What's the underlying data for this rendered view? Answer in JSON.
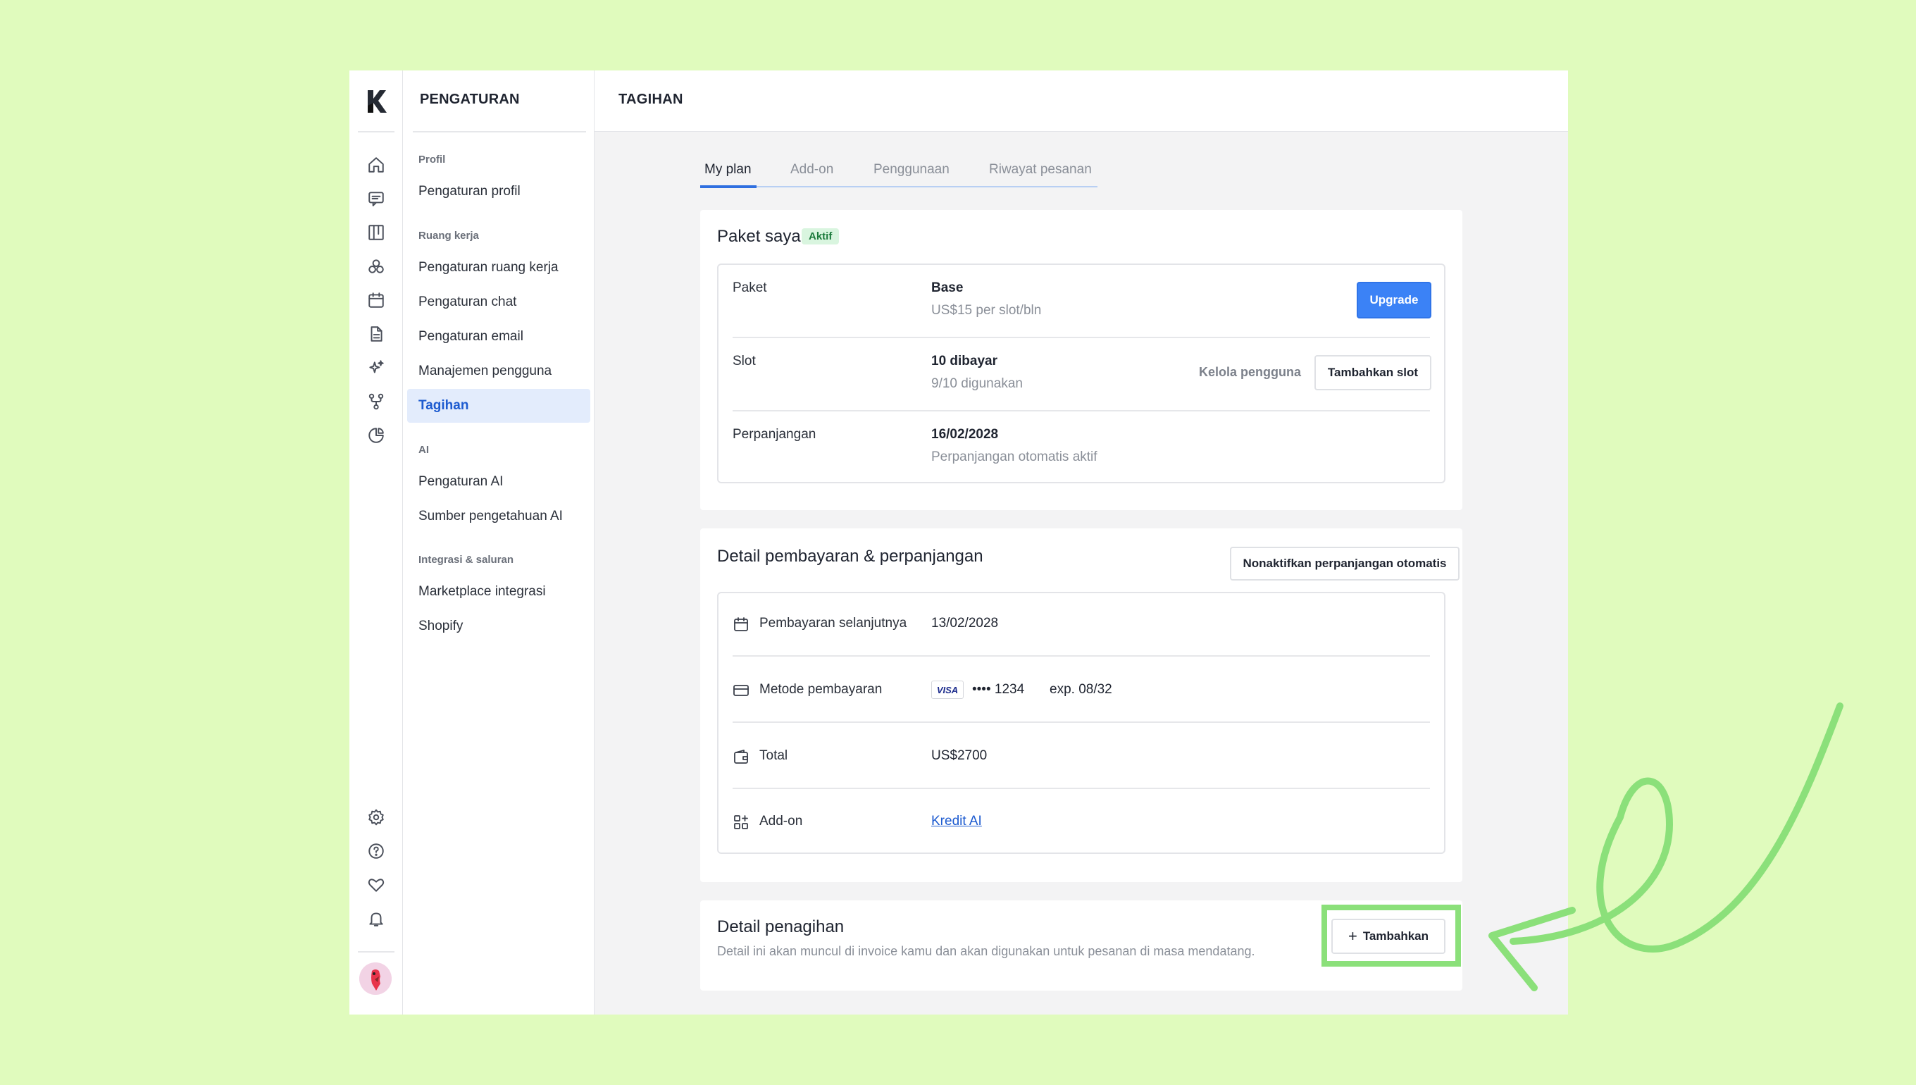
{
  "colors": {
    "background": "#e0fbbd",
    "accent": "#3b82f6",
    "highlight": "#8be07a"
  },
  "rail": {
    "icons": [
      "home-icon",
      "chat-icon",
      "board-icon",
      "contacts-icon",
      "calendar-icon",
      "document-icon",
      "sparkles-icon",
      "workflow-icon",
      "reports-icon"
    ],
    "bottom_icons": [
      "settings-icon",
      "help-icon",
      "heart-icon",
      "bell-icon"
    ]
  },
  "nav": {
    "title": "PENGATURAN",
    "groups": [
      {
        "label": "Profil",
        "items": [
          "Pengaturan profil"
        ]
      },
      {
        "label": "Ruang kerja",
        "items": [
          "Pengaturan ruang kerja",
          "Pengaturan chat",
          "Pengaturan email",
          "Manajemen pengguna",
          "Tagihan"
        ]
      },
      {
        "label": "AI",
        "items": [
          "Pengaturan AI",
          "Sumber pengetahuan AI"
        ]
      },
      {
        "label": "Integrasi & saluran",
        "items": [
          "Marketplace integrasi",
          "Shopify"
        ]
      }
    ],
    "active_item": "Tagihan"
  },
  "header": {
    "title": "TAGIHAN"
  },
  "tabs": [
    "My plan",
    "Add-on",
    "Penggunaan",
    "Riwayat pesanan"
  ],
  "active_tab": "My plan",
  "plan": {
    "title": "Paket saya",
    "badge": "Aktif",
    "rows": {
      "paket": {
        "label": "Paket",
        "value": "Base",
        "sub": "US$15 per slot/bln",
        "button": "Upgrade"
      },
      "slot": {
        "label": "Slot",
        "value": "10 dibayar",
        "sub": "9/10 digunakan",
        "link": "Kelola pengguna",
        "button": "Tambahkan slot"
      },
      "renewal": {
        "label": "Perpanjangan",
        "value": "16/02/2028",
        "sub": "Perpanjangan otomatis aktif"
      }
    }
  },
  "payment": {
    "title": "Detail pembayaran & perpanjangan",
    "button": "Nonaktifkan perpanjangan otomatis",
    "rows": {
      "next": {
        "label": "Pembayaran selanjutnya",
        "value": "13/02/2028"
      },
      "method": {
        "label": "Metode pembayaran",
        "card_brand": "VISA",
        "masked": "•••• 1234",
        "exp": "exp. 08/32"
      },
      "total": {
        "label": "Total",
        "value": "US$2700"
      },
      "addon": {
        "label": "Add-on",
        "value": "Kredit AI"
      }
    }
  },
  "billing": {
    "title": "Detail penagihan",
    "description": "Detail ini akan muncul di invoice kamu dan akan digunakan untuk pesanan di masa mendatang.",
    "button": "Tambahkan",
    "button_icon": "+"
  }
}
